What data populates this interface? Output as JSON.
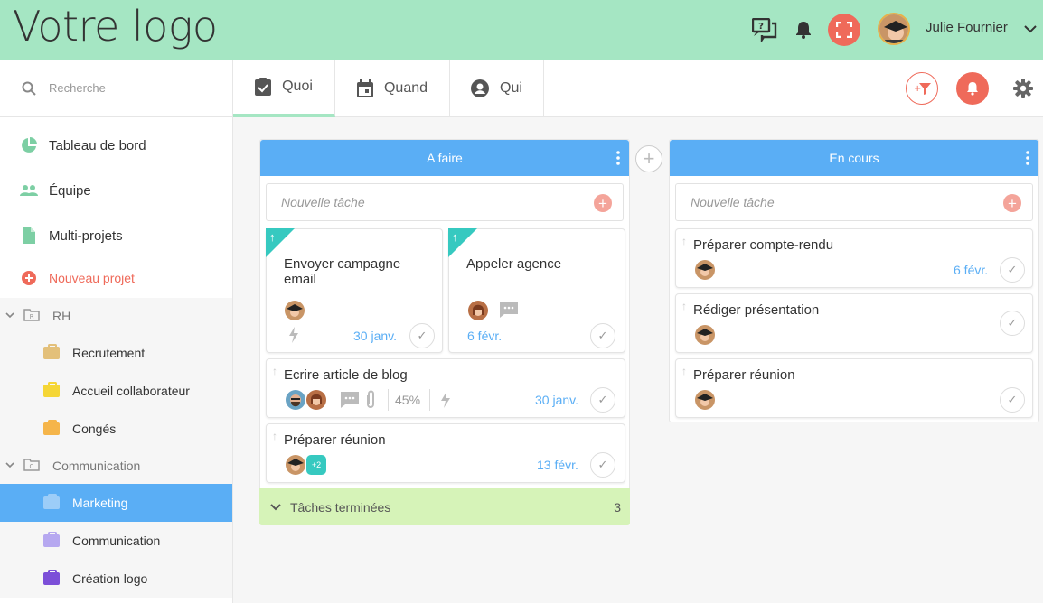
{
  "header": {
    "logo": "Votre logo",
    "user_name": "Julie Fournier"
  },
  "sidebar": {
    "search_placeholder": "Recherche",
    "nav": [
      {
        "label": "Tableau de bord",
        "icon": "pie-chart-icon"
      },
      {
        "label": "Équipe",
        "icon": "team-icon"
      },
      {
        "label": "Multi-projets",
        "icon": "document-icon"
      },
      {
        "label": "Nouveau projet",
        "icon": "plus-circle-icon"
      }
    ],
    "groups": [
      {
        "label": "RH",
        "projects": [
          {
            "label": "Recrutement",
            "color": "#e3c07a"
          },
          {
            "label": "Accueil collaborateur",
            "color": "#f5d636"
          },
          {
            "label": "Congés",
            "color": "#f5b54a"
          }
        ]
      },
      {
        "label": "Communication",
        "projects": [
          {
            "label": "Marketing",
            "color": "#9ccdf8"
          },
          {
            "label": "Communication",
            "color": "#b6a8f0"
          },
          {
            "label": "Création logo",
            "color": "#7c4fd8"
          }
        ]
      }
    ]
  },
  "tabs": [
    {
      "label": "Quoi",
      "icon": "clipboard-check-icon"
    },
    {
      "label": "Quand",
      "icon": "calendar-icon"
    },
    {
      "label": "Qui",
      "icon": "user-circle-icon"
    }
  ],
  "board": {
    "columns": [
      {
        "title": "A faire",
        "new_task_placeholder": "Nouvelle tâche",
        "cards": [
          {
            "title": "Envoyer campagne email",
            "date": "30 janv."
          },
          {
            "title": "Appeler agence",
            "date": "6 févr."
          },
          {
            "title": "Ecrire article de blog",
            "progress": "45%",
            "date": "30 janv."
          },
          {
            "title": "Préparer réunion",
            "extra_members": "+2",
            "date": "13 févr."
          }
        ],
        "done_label": "Tâches terminées",
        "done_count": "3"
      },
      {
        "title": "En cours",
        "new_task_placeholder": "Nouvelle tâche",
        "cards": [
          {
            "title": "Préparer compte-rendu",
            "date": "6 févr."
          },
          {
            "title": "Rédiger présentation"
          },
          {
            "title": "Préparer réunion"
          }
        ]
      }
    ]
  },
  "colors": {
    "header_bg": "#a5e6c3",
    "accent_blue": "#5aaef5",
    "accent_red": "#ef6a5a",
    "done_bg": "#d6f3b8",
    "priority_teal": "#36c9c0"
  }
}
